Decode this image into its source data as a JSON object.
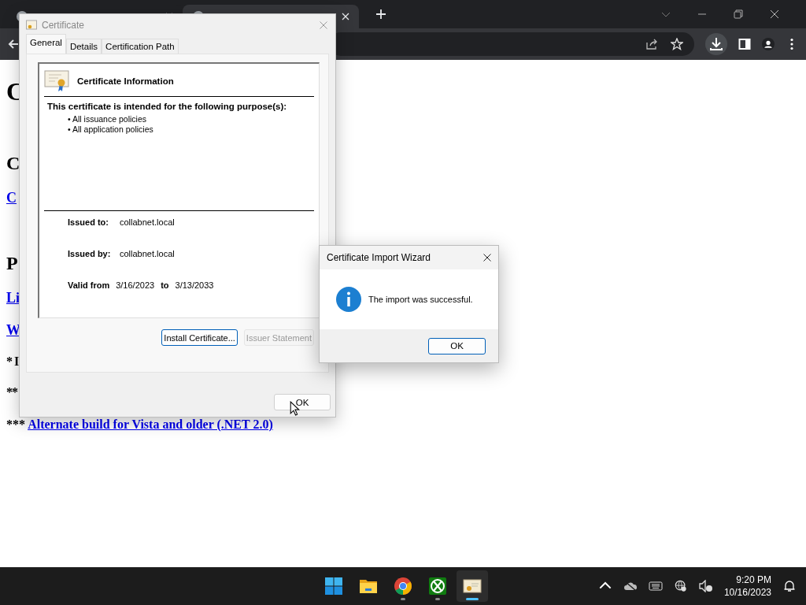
{
  "browser": {
    "tabs": [
      {
        "selected": false
      },
      {
        "selected": true
      }
    ]
  },
  "page": {
    "lines": [
      {
        "kind": "h1",
        "text": "C"
      },
      {
        "kind": "h2",
        "text": "C"
      },
      {
        "kind": "link",
        "text": "C"
      },
      {
        "kind": "h2",
        "text": "P"
      },
      {
        "kind": "link",
        "text": "Li"
      },
      {
        "kind": "link",
        "text": "W"
      },
      {
        "kind": "text",
        "text": "* I"
      },
      {
        "kind": "text",
        "text": "**"
      },
      {
        "kind": "mixed",
        "prefix": "***",
        "link": "Alternate build for Vista and older (.NET 2.0)"
      }
    ]
  },
  "certificate_dialog": {
    "title": "Certificate",
    "tabs": [
      {
        "label": "General",
        "selected": true
      },
      {
        "label": "Details",
        "selected": false
      },
      {
        "label": "Certification Path",
        "selected": false
      }
    ],
    "heading": "Certificate Information",
    "purpose_heading": "This certificate is intended for the following purpose(s):",
    "purposes": [
      "• All issuance policies",
      "• All application policies"
    ],
    "fields": [
      {
        "label": "Issued to:",
        "value": "collabnet.local"
      },
      {
        "label": "Issued by:",
        "value": "collabnet.local"
      }
    ],
    "valid": {
      "label": "Valid from",
      "from": "3/16/2023",
      "to_label": "to",
      "to": "3/13/2033"
    },
    "buttons": [
      {
        "label": "Install Certificate...",
        "disabled": false
      },
      {
        "label": "Issuer Statement",
        "disabled": true
      }
    ],
    "ok": "OK"
  },
  "wizard": {
    "title": "Certificate Import Wizard",
    "message": "The import was successful.",
    "ok": "OK"
  },
  "taskbar": {
    "apps": [
      {
        "kind": "start",
        "running": false
      },
      {
        "kind": "folder",
        "running": false
      },
      {
        "kind": "browser",
        "running": true
      },
      {
        "kind": "game",
        "running": true
      },
      {
        "kind": "certificate",
        "running": true
      }
    ],
    "time": "9:20 PM",
    "date": "10/16/2023"
  }
}
